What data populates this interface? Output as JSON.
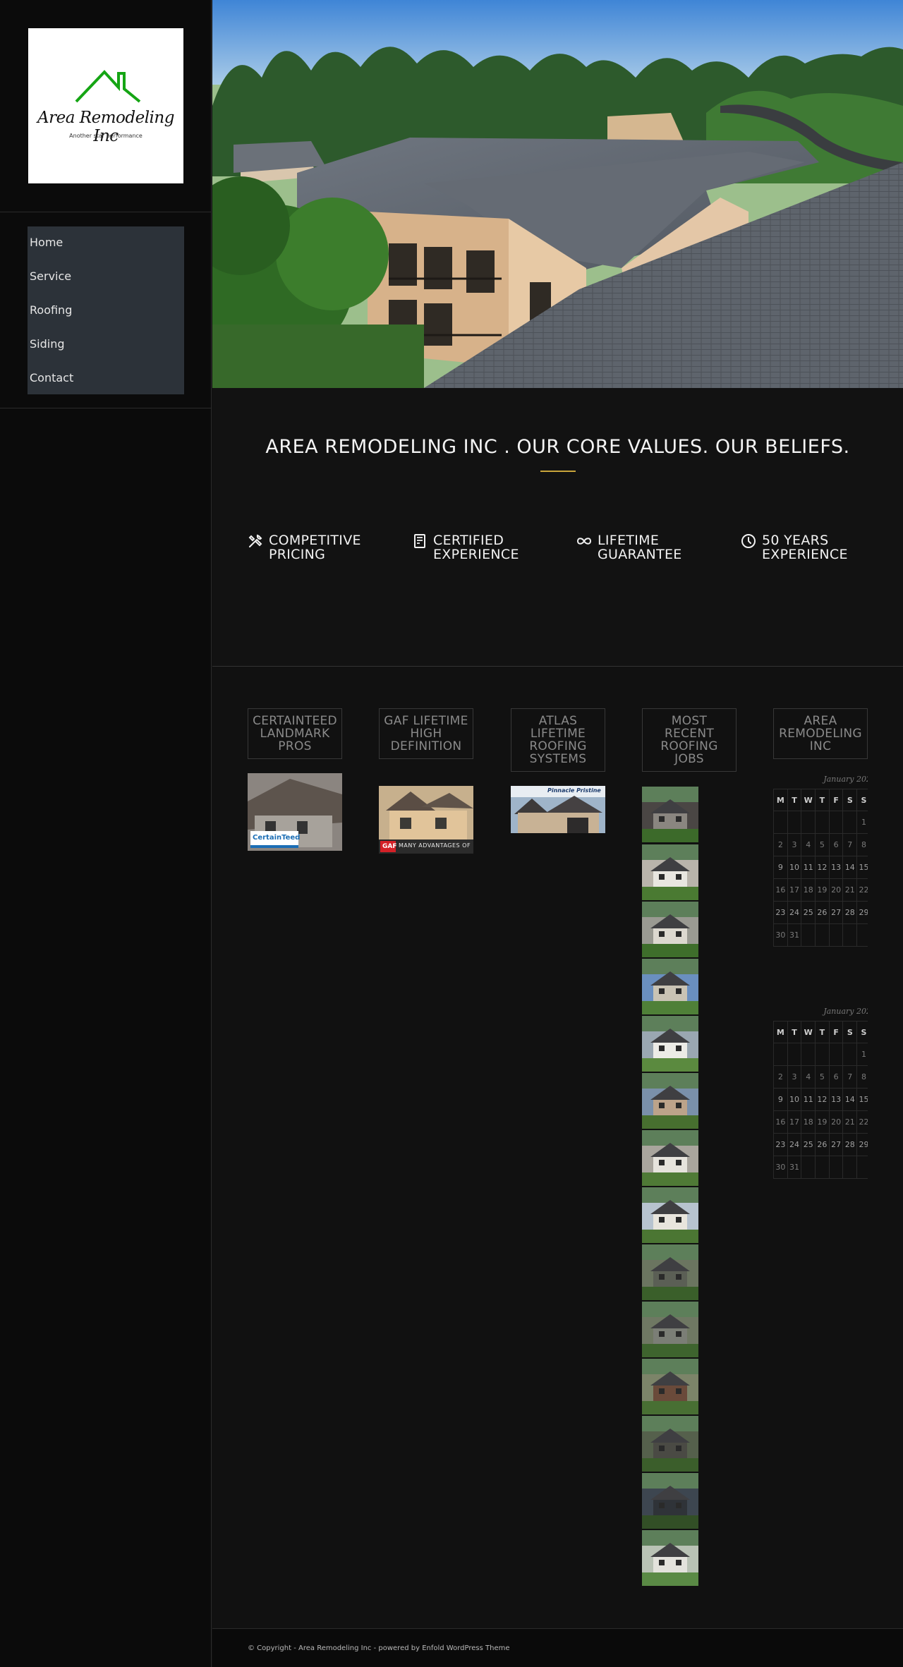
{
  "logo": {
    "name": "Area Remodeling Inc",
    "tagline": "Another star performance",
    "roof_color": "#15a514"
  },
  "nav": {
    "items": [
      {
        "label": "Home"
      },
      {
        "label": "Service"
      },
      {
        "label": "Roofing"
      },
      {
        "label": "Siding"
      },
      {
        "label": "Contact"
      }
    ]
  },
  "values": {
    "title": "AREA REMODELING INC . OUR CORE VALUES. OUR BELIEFS.",
    "accent_color": "#c9a53b",
    "features": [
      {
        "icon": "hammer-wrench-icon",
        "label": "COMPETITIVE PRICING"
      },
      {
        "icon": "certificate-icon",
        "label": "CERTIFIED EXPERIENCE"
      },
      {
        "icon": "infinity-icon",
        "label": "LIFETIME GUARANTEE"
      },
      {
        "icon": "clock-icon",
        "label": "50 YEARS EXPERIENCE"
      }
    ]
  },
  "columns": [
    {
      "title": "CERTAINTEED LANDMARK PROS",
      "badge": "CertainTeed"
    },
    {
      "title": "GAF LIFETIME HIGH DEFINITION",
      "badge": "GAF",
      "banner": "MANY ADVANTAGES OF"
    },
    {
      "title": "ATLAS LIFETIME ROOFING SYSTEMS",
      "badge": "Pinnacle Pristine"
    },
    {
      "title": "MOST RECENT ROOFING JOBS"
    },
    {
      "title": "AREA REMODELING INC"
    }
  ],
  "calendar": {
    "caption": "January 2023",
    "weekdays": [
      "M",
      "T",
      "W",
      "T",
      "F",
      "S",
      "S"
    ],
    "weeks": [
      [
        "",
        "",
        "",
        "",
        "",
        "",
        "1"
      ],
      [
        "2",
        "3",
        "4",
        "5",
        "6",
        "7",
        "8"
      ],
      [
        "9",
        "10",
        "11",
        "12",
        "13",
        "14",
        "15"
      ],
      [
        "16",
        "17",
        "18",
        "19",
        "20",
        "21",
        "22"
      ],
      [
        "23",
        "24",
        "25",
        "26",
        "27",
        "28",
        "29"
      ],
      [
        "30",
        "31",
        "",
        "",
        "",
        "",
        ""
      ]
    ]
  },
  "footer": {
    "text": "© Copyright - Area Remodeling Inc - powered by Enfold WordPress Theme"
  }
}
